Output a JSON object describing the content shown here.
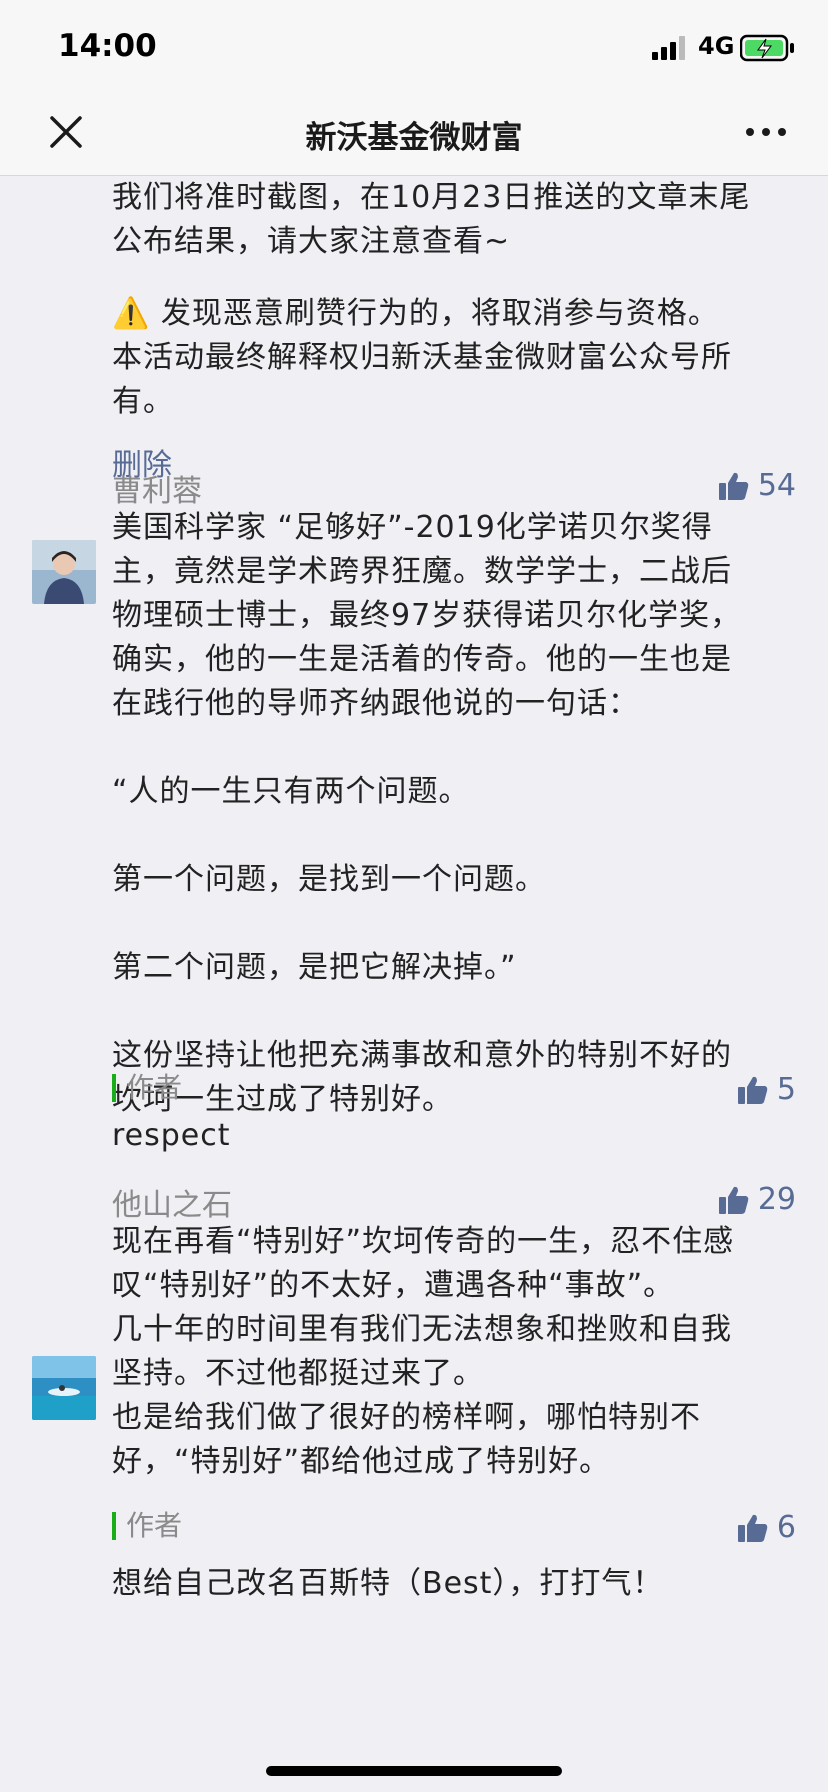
{
  "status_bar": {
    "time": "14:00",
    "network": "4G"
  },
  "nav": {
    "title": "新沃基金微财富"
  },
  "first_comment": {
    "lines": [
      "我们将准时截图，在10月23日推送的文章末尾",
      "公布结果，请大家注意查看~",
      "",
      "⚠️ 发现恶意刷赞行为的，将取消参与资格。",
      "本活动最终解释权归新沃基金微财富公众号所",
      "有。"
    ],
    "delete_label": "删除"
  },
  "comments": [
    {
      "nickname": "曹利蓉",
      "likes": "54",
      "lines": [
        "美国科学家 “足够好”-2019化学诺贝尔奖得",
        "主，竟然是学术跨界狂魔。数学学士，二战后",
        "物理硕士博士，最终97岁获得诺贝尔化学奖，",
        "确实，他的一生是活着的传奇。他的一生也是",
        "在践行他的导师齐纳跟他说的一句话：",
        "",
        "“人的一生只有两个问题。",
        "",
        "第一个问题，是找到一个问题。",
        "",
        "第二个问题，是把它解决掉。”",
        "",
        "这份坚持让他把充满事故和意外的特别不好的",
        "坎坷一生过成了特别好。"
      ],
      "author_tag": "作者",
      "author_likes": "5",
      "author_reply": "respect"
    },
    {
      "nickname": "他山之石",
      "likes": "29",
      "lines": [
        "现在再看“特别好”坎坷传奇的一生，忍不住感",
        "叹“特别好”的不太好，遭遇各种“事故”。",
        "几十年的时间里有我们无法想象和挫败和自我",
        "坚持。不过他都挺过来了。",
        "也是给我们做了很好的榜样啊，哪怕特别不",
        "好，“特别好”都给他过成了特别好。"
      ],
      "author_tag": "作者",
      "author_likes": "6",
      "author_reply": "想给自己改名百斯特（Best），打打气！"
    }
  ]
}
